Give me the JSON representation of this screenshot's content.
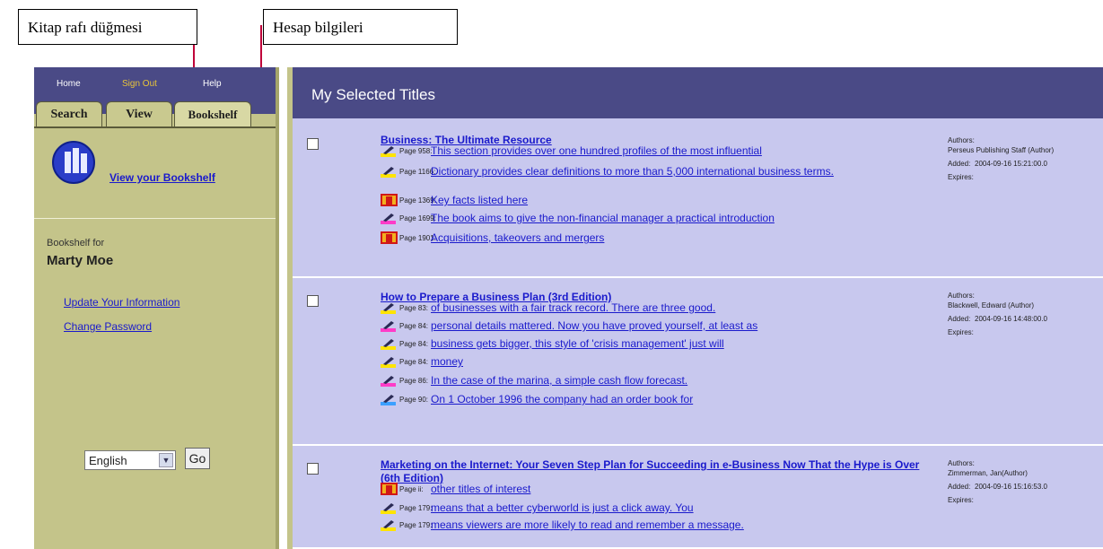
{
  "callouts": {
    "bookshelf_button": "Kitap rafı düğmesi",
    "account_info": "Hesap bilgileri"
  },
  "nav": {
    "home": "Home",
    "signout": "Sign Out",
    "help": "Help"
  },
  "tabs": [
    "Search",
    "View",
    "Bookshelf"
  ],
  "sidebar": {
    "view_bookshelf": "View your Bookshelf",
    "bookshelf_for": "Bookshelf for",
    "user_name": "Marty Moe",
    "update_info": "Update Your Information",
    "change_password": "Change Password",
    "language": "English",
    "go": "Go"
  },
  "main": {
    "title": "My Selected Titles",
    "labels": {
      "authors": "Authors:",
      "added": "Added:",
      "expires": "Expires:"
    },
    "titles": [
      {
        "title": "Business: The Ultimate Resource",
        "authors": "Perseus Publishing Staff (Author)",
        "added": "2004-09-16 15:21:00.0",
        "entries": [
          {
            "icon": "highlighter-icon",
            "page": "Page 958:",
            "text": "This section provides over one hundred profiles of the most influential"
          },
          {
            "icon": "highlighter-icon",
            "page": "Page 1166:",
            "text": "Dictionary provides clear definitions to more than 5,000 international business terms."
          },
          {
            "icon": "bookmark-icon",
            "page": "Page 1369:",
            "text": "Key facts listed here"
          },
          {
            "icon": "highlighter-icon",
            "page": "Page 1699:",
            "text": "The book aims to give the non-financial manager a practical introduction"
          },
          {
            "icon": "bookmark-icon",
            "page": "Page 1901:",
            "text": "Acquisitions, takeovers and mergers"
          }
        ]
      },
      {
        "title": "How to Prepare a Business Plan (3rd Edition)",
        "authors": "Blackwell, Edward (Author)",
        "added": "2004-09-16 14:48:00.0",
        "entries": [
          {
            "icon": "highlighter-icon",
            "page": "Page 83:",
            "text": "of businesses with a fair track record. There are three good."
          },
          {
            "icon": "highlighter-icon",
            "page": "Page 84:",
            "text": "personal details mattered. Now you have proved yourself, at least as"
          },
          {
            "icon": "highlighter-icon",
            "page": "Page 84:",
            "text": "business gets bigger, this style of 'crisis management' just will"
          },
          {
            "icon": "highlighter-icon",
            "page": "Page 84:",
            "text": "money"
          },
          {
            "icon": "highlighter-icon",
            "page": "Page 86:",
            "text": "In the case of the marina, a simple cash flow forecast."
          },
          {
            "icon": "highlighter-icon",
            "page": "Page 90:",
            "text": "On 1 October 1996 the company had an order book for"
          }
        ]
      },
      {
        "title": "Marketing on the Internet: Your Seven Step Plan for Succeeding in e-Business Now That the Hype is Over (6th Edition)",
        "authors": "Zimmerman, Jan(Author)",
        "added": "2004-09-16 15:16:53.0",
        "entries": [
          {
            "icon": "bookmark-icon",
            "page": "Page ii:",
            "text": "other titles of interest"
          },
          {
            "icon": "highlighter-icon",
            "page": "Page 179:",
            "text": "means that a better cyberworld is just a click away. You"
          },
          {
            "icon": "highlighter-icon",
            "page": "Page 179:",
            "text": "means viewers are more likely to read and remember a message."
          }
        ]
      }
    ]
  },
  "colors": {
    "nav_bg": "#4a4a86",
    "sidebar_bg": "#c4c48a",
    "content_bg": "#c8c8ee",
    "link": "#1a1acc",
    "callout_line": "#c0003a",
    "highlight_yellow": "#ffe400",
    "highlight_pink": "#ff3cc8",
    "highlight_blue": "#3ca0ff"
  }
}
